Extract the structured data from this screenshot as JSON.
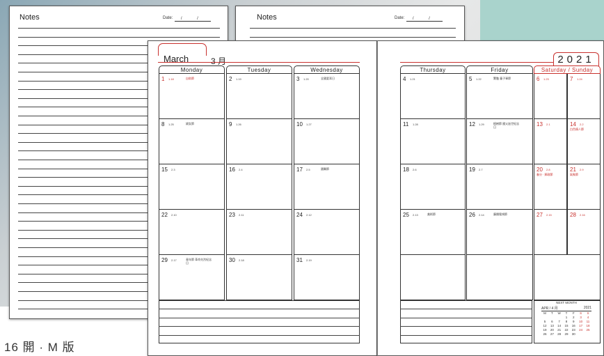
{
  "caption": "16 開 · M 版",
  "notes": {
    "title": "Notes",
    "date_label": "Date:",
    "date_slashes": "/ /"
  },
  "month": {
    "name_en": "March",
    "num_prefix": "3",
    "name_cn": "月",
    "year": "2021"
  },
  "weekdays_left": [
    "Monday",
    "Tuesday",
    "Wednesday"
  ],
  "weekdays_right": [
    "Thursday",
    "Friday",
    "Saturday / Sunday"
  ],
  "weeks": [
    [
      {
        "d": "1",
        "l": "1.18",
        "e": "自助節",
        "red": true
      },
      {
        "d": "2",
        "l": "1.19",
        "e": ""
      },
      {
        "d": "3",
        "l": "1.20",
        "e": "全國愛耳日"
      },
      {
        "d": "4",
        "l": "1.21",
        "e": ""
      },
      {
        "d": "5",
        "l": "1.22",
        "e": "驚蟄 童子軍節"
      },
      {
        "d": "6",
        "l": "1.23",
        "e": "",
        "red": true
      },
      {
        "d": "7",
        "l": "1.24",
        "e": "",
        "red": true
      }
    ],
    [
      {
        "d": "8",
        "l": "1.25",
        "e": "婦女節"
      },
      {
        "d": "9",
        "l": "1.26",
        "e": ""
      },
      {
        "d": "10",
        "l": "1.27",
        "e": ""
      },
      {
        "d": "11",
        "l": "1.28",
        "e": ""
      },
      {
        "d": "12",
        "l": "1.29",
        "e": "植樹節 國父逝世紀念日"
      },
      {
        "d": "13",
        "l": "2.1",
        "e": "",
        "red": true
      },
      {
        "d": "14",
        "l": "2.2",
        "e": "白色情人節",
        "red": true
      }
    ],
    [
      {
        "d": "15",
        "l": "2.3",
        "e": ""
      },
      {
        "d": "16",
        "l": "2.4",
        "e": ""
      },
      {
        "d": "17",
        "l": "2.5",
        "e": "國醫節"
      },
      {
        "d": "18",
        "l": "2.6",
        "e": ""
      },
      {
        "d": "19",
        "l": "2.7",
        "e": ""
      },
      {
        "d": "20",
        "l": "2.8",
        "e": "春分 · 郵政節",
        "red": true
      },
      {
        "d": "21",
        "l": "2.9",
        "e": "氣象節",
        "red": true
      }
    ],
    [
      {
        "d": "22",
        "l": "2.10",
        "e": ""
      },
      {
        "d": "23",
        "l": "2.11",
        "e": ""
      },
      {
        "d": "24",
        "l": "2.12",
        "e": ""
      },
      {
        "d": "25",
        "l": "2.13",
        "e": "美術節"
      },
      {
        "d": "26",
        "l": "2.14",
        "e": "廣播電視節"
      },
      {
        "d": "27",
        "l": "2.15",
        "e": "",
        "red": true
      },
      {
        "d": "28",
        "l": "2.16",
        "e": "",
        "red": true
      }
    ],
    [
      {
        "d": "29",
        "l": "2.17",
        "e": "青年節 革命先烈紀念日"
      },
      {
        "d": "30",
        "l": "2.18",
        "e": ""
      },
      {
        "d": "31",
        "l": "2.19",
        "e": ""
      },
      {
        "d": "",
        "l": "",
        "e": ""
      },
      {
        "d": "",
        "l": "",
        "e": ""
      },
      {
        "d": "",
        "l": "",
        "e": ""
      },
      {
        "d": "",
        "l": "",
        "e": ""
      }
    ]
  ],
  "next_month": {
    "label": "NEXT MONTH",
    "month": "APR / 4 月",
    "year": "2021",
    "days_hdr": [
      "M",
      "T",
      "W",
      "T",
      "F",
      "S",
      "S"
    ],
    "rows": [
      [
        "",
        "",
        "",
        "1",
        "2",
        "3",
        "4"
      ],
      [
        "5",
        "6",
        "7",
        "8",
        "9",
        "10",
        "11"
      ],
      [
        "12",
        "13",
        "14",
        "15",
        "16",
        "17",
        "18"
      ],
      [
        "19",
        "20",
        "21",
        "22",
        "23",
        "24",
        "25"
      ],
      [
        "26",
        "27",
        "28",
        "29",
        "30",
        "",
        ""
      ]
    ]
  }
}
